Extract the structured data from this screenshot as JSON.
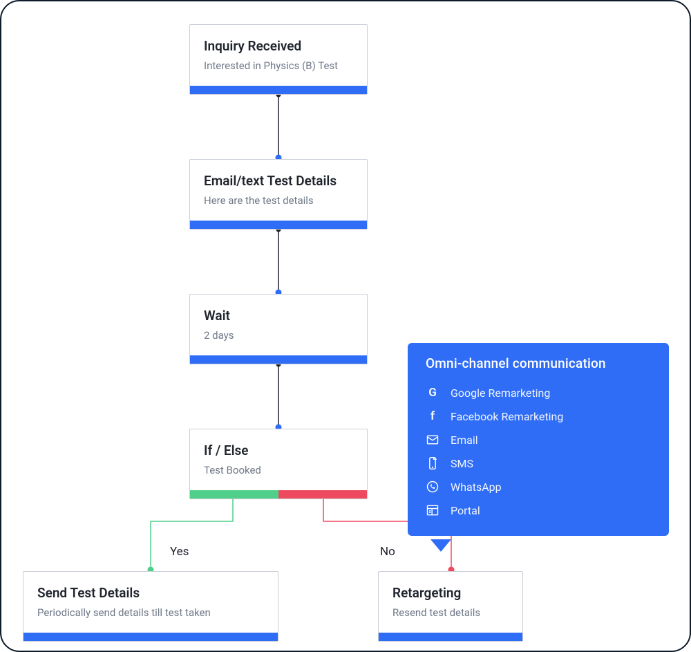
{
  "nodes": {
    "inquiry": {
      "title": "Inquiry Received",
      "sub": "Interested in Physics (B) Test"
    },
    "email": {
      "title": "Email/text Test Details",
      "sub": "Here are the test details"
    },
    "wait": {
      "title": "Wait",
      "sub": "2 days"
    },
    "ifelse": {
      "title": "If / Else",
      "sub": "Test Booked"
    },
    "send": {
      "title": "Send Test Details",
      "sub": "Periodically send details till test taken"
    },
    "retarget": {
      "title": "Retargeting",
      "sub": "Resend test details"
    }
  },
  "branches": {
    "yes": "Yes",
    "no": "No"
  },
  "callout": {
    "heading": "Omni-channel communication",
    "items": [
      {
        "icon": "google",
        "label": "Google Remarketing"
      },
      {
        "icon": "facebook",
        "label": "Facebook Remarketing"
      },
      {
        "icon": "email",
        "label": "Email"
      },
      {
        "icon": "sms",
        "label": "SMS"
      },
      {
        "icon": "whatsapp",
        "label": "WhatsApp"
      },
      {
        "icon": "portal",
        "label": "Portal"
      }
    ]
  },
  "colors": {
    "primary": "#2f6df6",
    "yes": "#4fcf8a",
    "no": "#ed4a60",
    "border": "#c9ced6"
  }
}
